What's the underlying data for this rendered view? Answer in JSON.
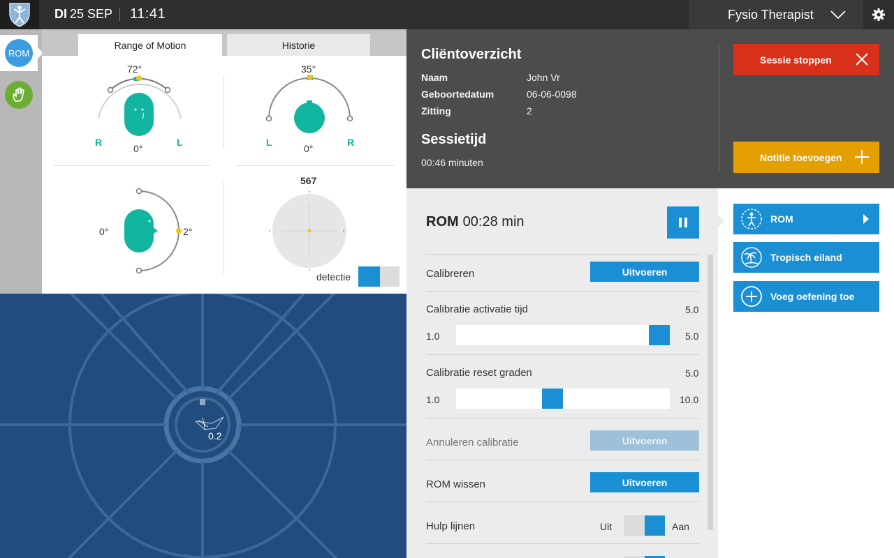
{
  "header": {
    "day": "DI",
    "date": "25 SEP",
    "time": "11:41",
    "user": "Fysio Therapist",
    "logo_icon": "vitruvian-logo-icon",
    "settings_icon": "gear-icon"
  },
  "rail": {
    "items": [
      {
        "label": "ROM",
        "icon": "rom-icon",
        "color": "#3d9be0"
      },
      {
        "label": "",
        "icon": "hand-icon",
        "color": "#6cad34"
      }
    ]
  },
  "viewer": {
    "tabs": [
      "Range of Motion",
      "Historie"
    ],
    "gauge_rot": {
      "top": "72°",
      "bottom": "0°",
      "left": "R",
      "right": "L"
    },
    "gauge_tilt": {
      "top": "35°",
      "bottom": "0°",
      "left": "L",
      "right": "R"
    },
    "gauge_flex": {
      "left": "0°",
      "right": "2°"
    },
    "target": {
      "value": "567",
      "detect_label": "detectie"
    }
  },
  "game": {
    "value": "0.2"
  },
  "client": {
    "title": "Cliëntoverzicht",
    "fields": [
      {
        "label": "Naam",
        "value": "John Vr"
      },
      {
        "label": "Geboortedatum",
        "value": "06-06-0098"
      },
      {
        "label": "Zitting",
        "value": "2"
      }
    ],
    "session_title": "Sessietijd",
    "session_time": "00:46 minuten",
    "stop_label": "Sessie stoppen",
    "note_label": "Notitie toevoegen",
    "colors": {
      "stop": "#d8311a",
      "note": "#e4a000"
    }
  },
  "settings": {
    "exercise": "ROM",
    "timer": "00:28 min",
    "calibrate_label": "Calibreren",
    "run_label": "Uitvoeren",
    "act_time": {
      "label": "Calibratie activatie tijd",
      "value": "5.0",
      "min": "1.0",
      "max": "5.0",
      "fraction": 1.0
    },
    "reset_deg": {
      "label": "Calibratie reset graden",
      "value": "5.0",
      "min": "1.0",
      "max": "10.0",
      "fraction": 0.444
    },
    "cancel_label": "Annuleren calibratie",
    "clear_label": "ROM wissen",
    "guides_label": "Hulp lijnen",
    "off_label": "Uit",
    "on_label": "Aan"
  },
  "exercises": {
    "items": [
      {
        "label": "ROM",
        "icon": "rom-icon"
      },
      {
        "label": "Tropisch eiland",
        "icon": "palm-tree-icon"
      },
      {
        "label": "Voeg oefening toe",
        "icon": "plus-circle-icon"
      }
    ]
  }
}
